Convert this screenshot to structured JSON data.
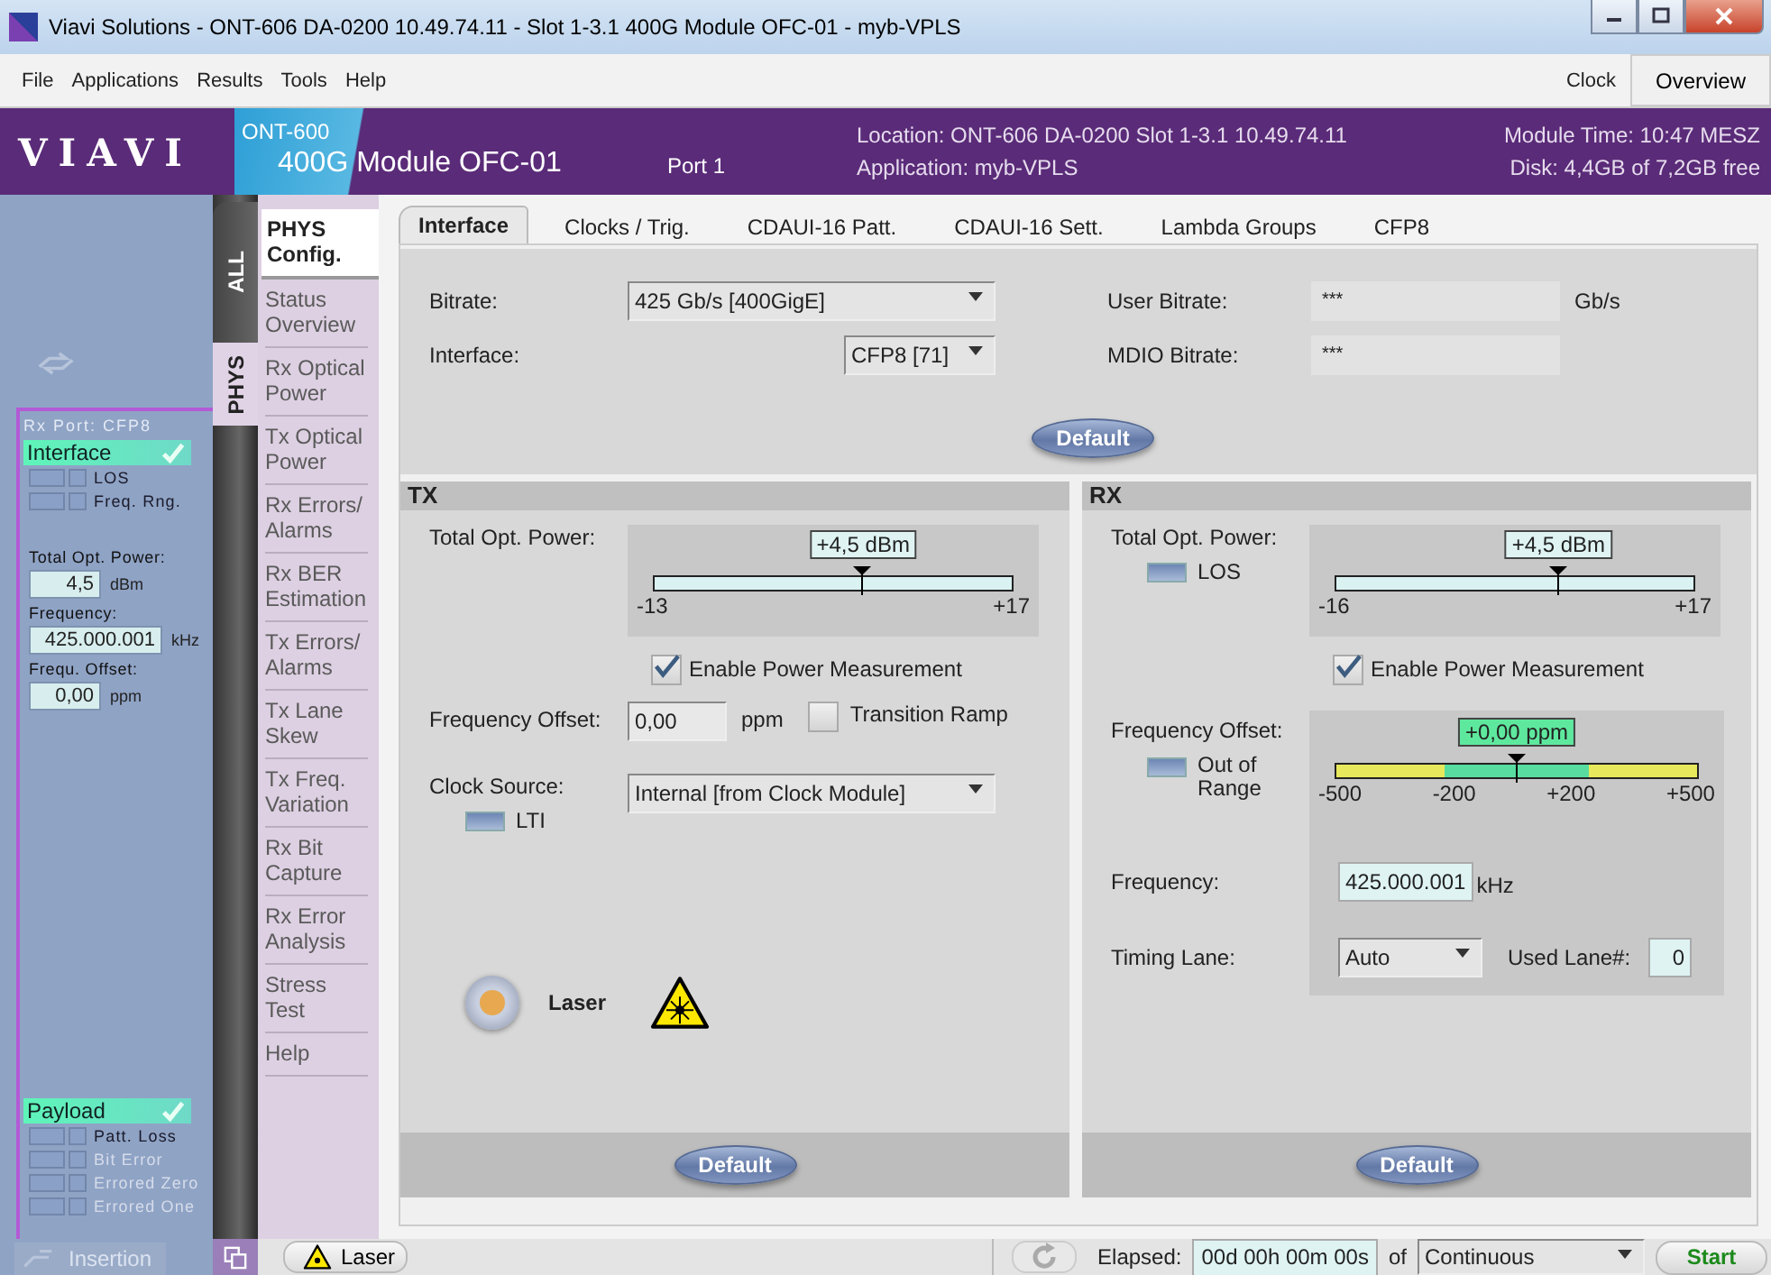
{
  "window": {
    "title": "Viavi Solutions - ONT-606  DA-0200 10.49.74.11 - Slot 1-3.1 400G Module OFC-01 - myb-VPLS"
  },
  "menu": [
    "File",
    "Applications",
    "Results",
    "Tools",
    "Help"
  ],
  "menu_right": {
    "clock": "Clock",
    "overview": "Overview"
  },
  "header": {
    "logo": "VIAVI",
    "product": "ONT-600",
    "module": "400G Module OFC-01",
    "port": "Port 1",
    "location": "Location: ONT-606 DA-0200 Slot 1-3.1  10.49.74.11",
    "application": "Application: myb-VPLS",
    "module_time": "Module Time: 10:47 MESZ",
    "disk": "Disk: 4,4GB of 7,2GB free"
  },
  "status_panel": {
    "port": "Rx Port: CFP8",
    "interface": {
      "name": "Interface",
      "ok": true,
      "alarms": [
        {
          "label": "LOS",
          "active": false,
          "disabled": false
        },
        {
          "label": "Freq. Rng.",
          "active": false,
          "disabled": false
        }
      ]
    },
    "fields": [
      {
        "label": "Total Opt. Power:",
        "value": "4,5",
        "unit": "dBm"
      },
      {
        "label": "Frequency:",
        "value": "425.000.001",
        "unit": "kHz"
      },
      {
        "label": "Frequ. Offset:",
        "value": "0,00",
        "unit": "ppm"
      }
    ],
    "payload": {
      "name": "Payload",
      "ok": true,
      "alarms": [
        {
          "label": "Patt. Loss",
          "active": false,
          "disabled": false
        },
        {
          "label": "Bit Error",
          "active": false,
          "disabled": true
        },
        {
          "label": "Errored Zero",
          "active": false,
          "disabled": true
        },
        {
          "label": "Errored One",
          "active": false,
          "disabled": true
        }
      ]
    },
    "insertion": "Insertion"
  },
  "vertical_tabs": [
    {
      "label": "ALL",
      "selected": false
    },
    {
      "label": "PHYS",
      "selected": true
    }
  ],
  "nav": [
    {
      "label": "PHYS\nConfig.",
      "selected": true
    },
    {
      "label": "Status\nOverview",
      "selected": false
    },
    {
      "label": "Rx Optical\nPower",
      "selected": false
    },
    {
      "label": "Tx Optical\nPower",
      "selected": false
    },
    {
      "label": "Rx Errors/\nAlarms",
      "selected": false
    },
    {
      "label": "Rx BER\nEstimation",
      "selected": false
    },
    {
      "label": "Tx Errors/\nAlarms",
      "selected": false
    },
    {
      "label": "Tx Lane\nSkew",
      "selected": false
    },
    {
      "label": "Tx Freq.\nVariation",
      "selected": false
    },
    {
      "label": "Rx Bit\nCapture",
      "selected": false
    },
    {
      "label": "Rx Error\nAnalysis",
      "selected": false
    },
    {
      "label": "Stress\nTest",
      "selected": false
    },
    {
      "label": "Help",
      "selected": false
    }
  ],
  "tabs": [
    {
      "label": "Interface",
      "selected": true
    },
    {
      "label": "Clocks / Trig.",
      "selected": false
    },
    {
      "label": "CDAUI-16 Patt.",
      "selected": false
    },
    {
      "label": "CDAUI-16 Sett.",
      "selected": false
    },
    {
      "label": "Lambda Groups",
      "selected": false
    },
    {
      "label": "CFP8",
      "selected": false
    }
  ],
  "interface_settings": {
    "bitrate": {
      "label": "Bitrate:",
      "value": "425 Gb/s [400GigE]"
    },
    "interface": {
      "label": "Interface:",
      "value": "CFP8 [71]"
    },
    "user_bitrate": {
      "label": "User Bitrate:",
      "value": "***",
      "unit": "Gb/s"
    },
    "mdio_bitrate": {
      "label": "MDIO Bitrate:",
      "value": "***"
    },
    "default": "Default"
  },
  "tx": {
    "title": "TX",
    "power": {
      "label": "Total Opt. Power:",
      "reading": "+4,5 dBm",
      "level": 0.583,
      "min": "-13",
      "max": "+17"
    },
    "enable": {
      "label": "Enable Power Measurement",
      "checked": true
    },
    "freq_offset": {
      "label": "Frequency Offset:",
      "value": "0,00",
      "unit": "ppm"
    },
    "transition_ramp": {
      "label": "Transition Ramp",
      "checked": false
    },
    "clock_source": {
      "label": "Clock Source:",
      "value": "Internal [from Clock Module]",
      "led": {
        "label": "LTI",
        "active": false
      }
    },
    "laser": {
      "label": "Laser",
      "on": false
    },
    "default": "Default"
  },
  "rx": {
    "title": "RX",
    "power": {
      "label": "Total Opt. Power:",
      "led": {
        "label": "LOS",
        "active": false
      },
      "reading": "+4,5 dBm",
      "level": 0.621,
      "min": "-16",
      "max": "+17"
    },
    "enable": {
      "label": "Enable Power Measurement",
      "checked": true
    },
    "freq_offset": {
      "label": "Frequency Offset:",
      "led": {
        "label": "Out of\nRange",
        "active": false
      },
      "reading": "+0,00 ppm",
      "level": 0.5,
      "ticks": [
        "-500",
        "-200",
        "+200",
        "+500"
      ]
    },
    "frequency": {
      "label": "Frequency:",
      "value": "425.000.001",
      "unit": "kHz"
    },
    "timing_lane": {
      "label": "Timing Lane:",
      "value": "Auto"
    },
    "used_lane": {
      "label": "Used Lane#:",
      "value": "0"
    },
    "default": "Default"
  },
  "status_bar": {
    "laser": "Laser",
    "elapsed_label": "Elapsed:",
    "elapsed": "00d 00h 00m 00s",
    "of": "of",
    "mode": "Continuous",
    "start": "Start"
  }
}
